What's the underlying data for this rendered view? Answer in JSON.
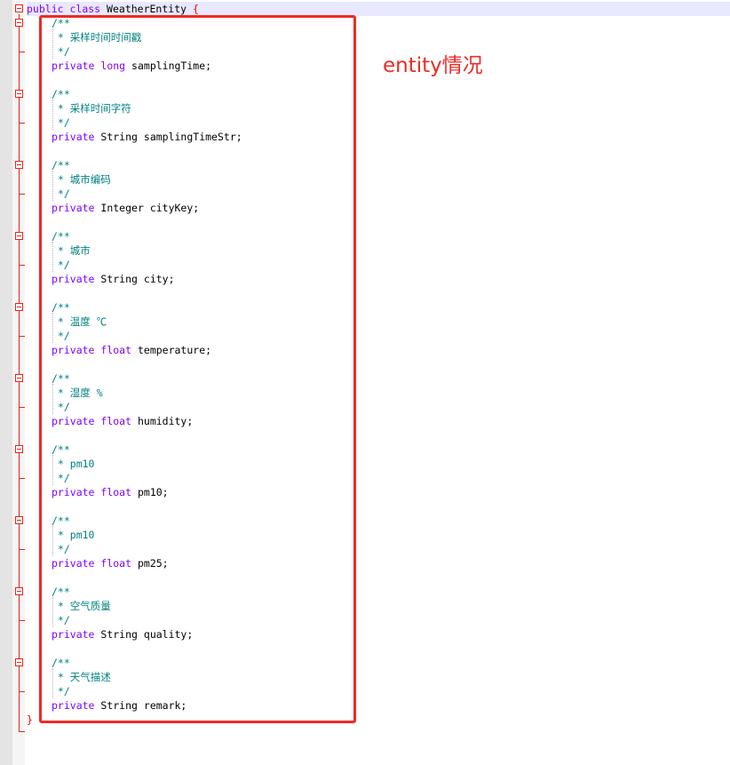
{
  "class_decl": {
    "kw_public": "public",
    "kw_class": "class",
    "name": "WeatherEntity",
    "brace": "{"
  },
  "closing_brace": "}",
  "annotation": "entity情况",
  "fields": [
    {
      "comment_open": "/**",
      "comment_text": " * 采样时间时间戳",
      "comment_close": " */",
      "modifier": "private",
      "type": "long",
      "name": "samplingTime;"
    },
    {
      "comment_open": "/**",
      "comment_text": " * 采样时间字符",
      "comment_close": " */",
      "modifier": "private",
      "type": "String",
      "name": "samplingTimeStr;"
    },
    {
      "comment_open": "/**",
      "comment_text": " * 城市编码",
      "comment_close": " */",
      "modifier": "private",
      "type": "Integer",
      "name": "cityKey;"
    },
    {
      "comment_open": "/**",
      "comment_text": " * 城市",
      "comment_close": " */",
      "modifier": "private",
      "type": "String",
      "name": "city;"
    },
    {
      "comment_open": "/**",
      "comment_text": " * 温度 ℃",
      "comment_close": " */",
      "modifier": "private",
      "type": "float",
      "name": "temperature;"
    },
    {
      "comment_open": "/**",
      "comment_text": " * 湿度 %",
      "comment_close": " */",
      "modifier": "private",
      "type": "float",
      "name": "humidity;"
    },
    {
      "comment_open": "/**",
      "comment_text": " * pm10",
      "comment_close": " */",
      "modifier": "private",
      "type": "float",
      "name": "pm10;"
    },
    {
      "comment_open": "/**",
      "comment_text": " * pm10",
      "comment_close": " */",
      "modifier": "private",
      "type": "float",
      "name": "pm25;"
    },
    {
      "comment_open": "/**",
      "comment_text": " * 空气质量",
      "comment_close": " */",
      "modifier": "private",
      "type": "String",
      "name": "quality;"
    },
    {
      "comment_open": "/**",
      "comment_text": " * 天气描述",
      "comment_close": " */",
      "modifier": "private",
      "type": "String",
      "name": "remark;"
    }
  ],
  "colors": {
    "keyword": "#8000ff",
    "comment": "#008080",
    "brace": "#ff0000",
    "annotation": "#ee2a24"
  }
}
